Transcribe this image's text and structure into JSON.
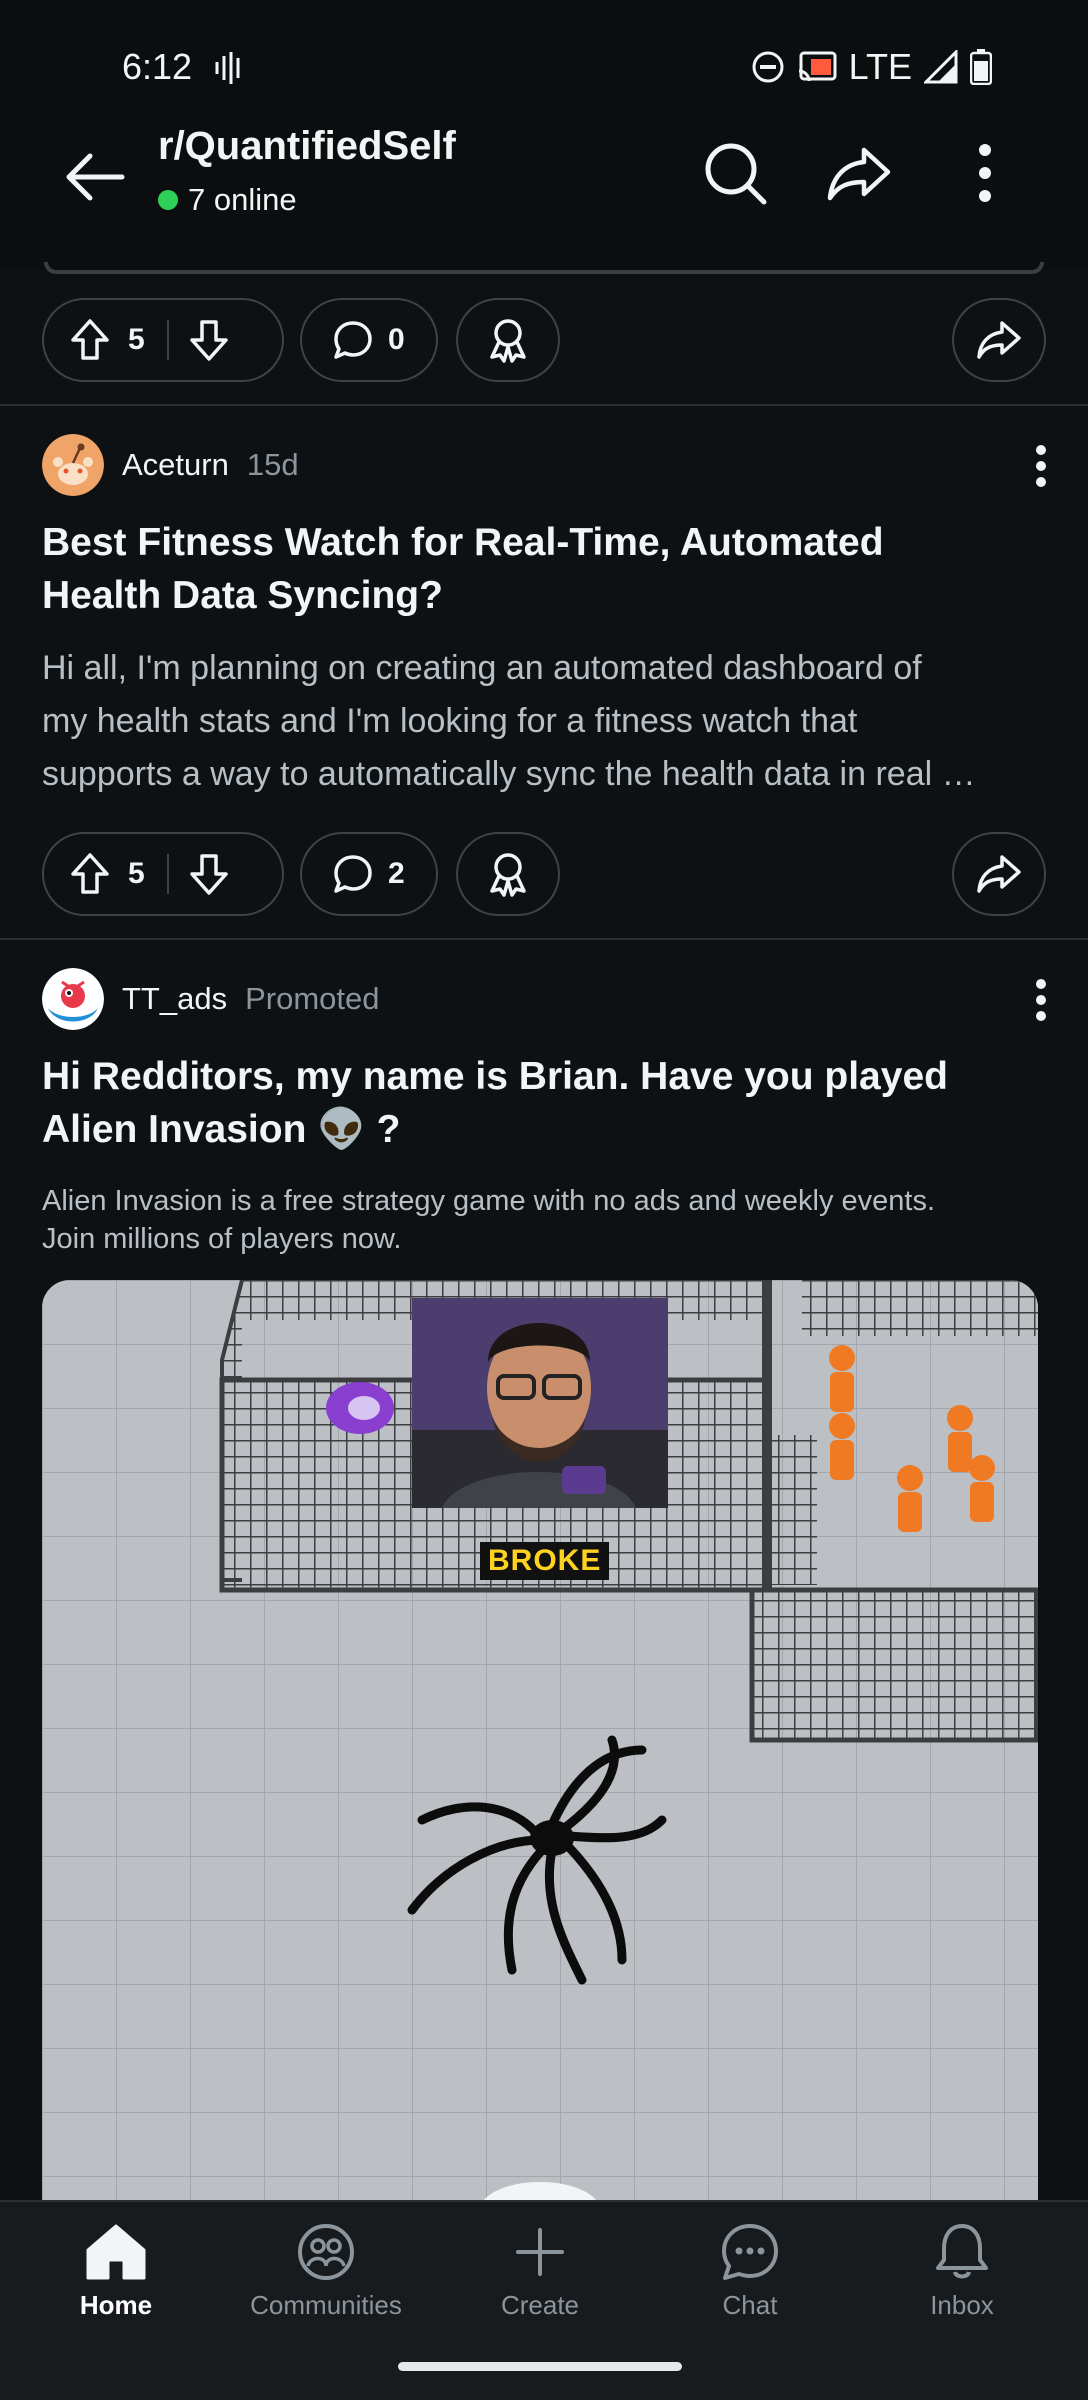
{
  "status_bar": {
    "time": "6:12",
    "network": "LTE"
  },
  "header": {
    "subreddit": "r/QuantifiedSelf",
    "online": "7 online"
  },
  "prev_post": {
    "upvotes": "5",
    "comments": "0"
  },
  "posts": [
    {
      "author": "Aceturn",
      "age": "15d",
      "title_lines": [
        "Best Fitness Watch for Real-Time, Automated",
        "Health Data Syncing?"
      ],
      "body_lines": [
        "Hi all, I'm planning on creating an automated dashboard of",
        "my health stats and I'm looking for a fitness watch that",
        "supports a way to automatically sync the health data in real …"
      ],
      "upvotes": "5",
      "comments": "2"
    }
  ],
  "ad": {
    "author": "TT_ads",
    "label": "Promoted",
    "title_lines": [
      "Hi Redditors, my name is Brian. Have you played",
      "Alien Invasion 👽 ?"
    ],
    "body_lines": [
      "Alien Invasion is a free strategy game with no ads and weekly events.",
      "Join millions of players now."
    ],
    "image_caption": "BROKE"
  },
  "bottom_nav": {
    "items": [
      {
        "label": "Home",
        "icon": "home-icon"
      },
      {
        "label": "Communities",
        "icon": "communities-icon"
      },
      {
        "label": "Create",
        "icon": "plus-icon"
      },
      {
        "label": "Chat",
        "icon": "chat-icon"
      },
      {
        "label": "Inbox",
        "icon": "bell-icon"
      }
    ],
    "active": "Home"
  },
  "colors": {
    "background": "#0e1113",
    "online_dot": "#2ed158",
    "muted_text": "#8c959c",
    "caption_yellow": "#ffd21f"
  }
}
